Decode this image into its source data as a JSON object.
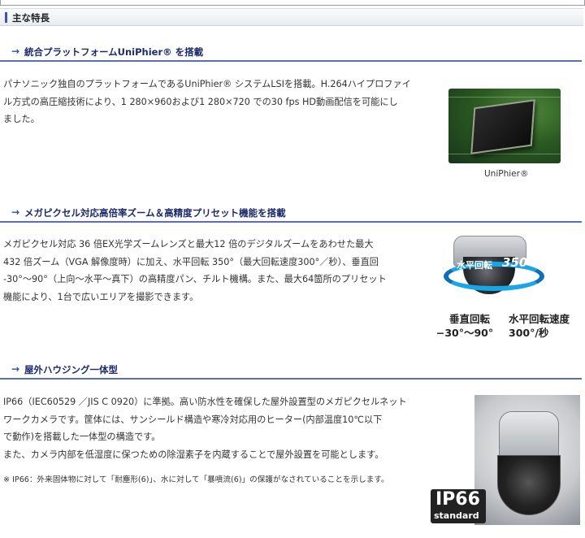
{
  "main": {
    "title": "主な特長"
  },
  "sections": [
    {
      "arrow": "→",
      "heading": "統合プラットフォームUniPhier® を搭載",
      "lines": [
        "パナソニック独自のプラットフォームであるUniPhier® システムLSIを搭載。H.264ハイプロファイ",
        "ル方式の高圧縮技術により、1 280×960および1 280×720 での30 fps HD動画配信を可能にし",
        "ました。"
      ],
      "image_caption": "UniPhier®"
    },
    {
      "arrow": "→",
      "heading": "メガピクセル対応高倍率ズーム＆高精度プリセット機能を搭載",
      "lines": [
        "メガピクセル対応 36 倍EX光学ズームレンズと最大12 倍のデジタルズームをあわせた最大",
        "432 倍ズーム（VGA 解像度時）に加え、水平回転 350°（最大回転速度300°／秒）、垂直回",
        "-30°～90°（上向～水平～真下）の高精度パン、チルト機構。また、最大64箇所のプリセット",
        "機能により、1台で広いエリアを撮影できます。"
      ],
      "image": {
        "overlay_label": "水平回転",
        "overlay_degree": "350°",
        "spec_left_title": "垂直回転",
        "spec_left_value": "−30°～90°",
        "spec_right_title": "水平回転速度",
        "spec_right_value": "300°/秒"
      }
    },
    {
      "arrow": "→",
      "heading": "屋外ハウジング一体型",
      "lines": [
        "IP66（IEC60529 ／JIS C 0920）に準拠。高い防水性を確保した屋外設置型のメガピクセルネット",
        "ワークカメラです。筐体には、サンシールド構造や寒冷対応用のヒーター(内部温度10℃以下",
        "で動作)を搭載した一体型の構造です。"
      ],
      "extra_line": "また、カメラ内部を低湿度に保つための除湿素子を内蔵することで屋外設置を可能とします。",
      "note": "※ IP66：外来固体物に対して「耐塵形(6)」、水に対して「暴噴流(6)」の保護がなされていることを示します。",
      "badge": {
        "big": "IP66",
        "small": "standard"
      }
    }
  ],
  "colors": {
    "heading_text": "#1c2a6b",
    "rule": "#5a6fb2",
    "accent": "#3b55a2"
  }
}
